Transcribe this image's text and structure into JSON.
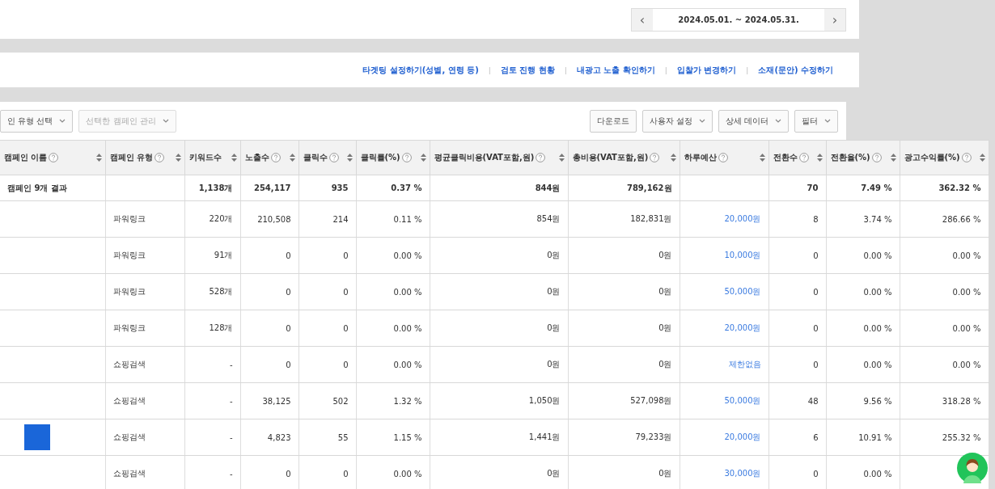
{
  "date_range": {
    "label": "2024.05.01. ~ 2024.05.31.",
    "prev": "‹",
    "next": "›"
  },
  "links": [
    {
      "kind": "link",
      "text": "타겟팅 설정하기(성별, 연령 등)"
    },
    {
      "kind": "separator",
      "text": "|"
    },
    {
      "kind": "link",
      "text": "검토 진행 현황"
    },
    {
      "kind": "separator",
      "text": "|"
    },
    {
      "kind": "link",
      "text": "내광고 노출 확인하기"
    },
    {
      "kind": "separator",
      "text": "|"
    },
    {
      "kind": "link",
      "text": "입찰가 변경하기"
    },
    {
      "kind": "separator",
      "text": "|"
    },
    {
      "kind": "link",
      "text": "소재(문안) 수정하기"
    }
  ],
  "toolbar_left": [
    {
      "label": "인 유형 선택",
      "disabled": false
    },
    {
      "label": "선택한 캠페인 관리",
      "disabled": true
    }
  ],
  "toolbar_right": [
    {
      "label": "다운로드",
      "dropdown": false
    },
    {
      "label": "사용자 설정",
      "dropdown": true
    },
    {
      "label": "상세 데이터",
      "dropdown": true
    },
    {
      "label": "필터",
      "dropdown": true
    }
  ],
  "table": {
    "columns": [
      {
        "label": "캠페인 이름",
        "help": true,
        "kind": "text"
      },
      {
        "label": "캠페인 유형",
        "help": true,
        "kind": "text"
      },
      {
        "label": "키워드수",
        "help": false,
        "kind": "number"
      },
      {
        "label": "노출수",
        "help": true,
        "kind": "number"
      },
      {
        "label": "클릭수",
        "help": true,
        "kind": "number"
      },
      {
        "label": "클릭률(%)",
        "help": true,
        "kind": "number"
      },
      {
        "label": "평균클릭비용(VAT포함,원)",
        "help": true,
        "kind": "number"
      },
      {
        "label": "총비용(VAT포함,원)",
        "help": true,
        "kind": "number"
      },
      {
        "label": "하루예산",
        "help": true,
        "kind": "link"
      },
      {
        "label": "전환수",
        "help": true,
        "kind": "number"
      },
      {
        "label": "전환율(%)",
        "help": true,
        "kind": "number"
      },
      {
        "label": "광고수익률(%)",
        "help": true,
        "kind": "number"
      }
    ],
    "total": {
      "campaign_name": "캠페인 9개 결과",
      "keywords": "1,138개",
      "impressions": "254,117",
      "clicks": "935",
      "ctr": "0.37 %",
      "avg_cpc": "844원",
      "total_cost": "789,162원",
      "conversions": "70",
      "conversion_rate": "7.49 %",
      "roas": "362.32 %"
    },
    "rows": [
      {
        "marked": false,
        "campaign_type": "파워링크",
        "keywords": "220개",
        "impressions": "210,508",
        "clicks": "214",
        "ctr": "0.11 %",
        "avg_cpc": "854원",
        "total_cost": "182,831원",
        "daily_budget": "20,000원",
        "conversions": "8",
        "conversion_rate": "3.74 %",
        "roas": "286.66 %"
      },
      {
        "marked": false,
        "campaign_type": "파워링크",
        "keywords": "91개",
        "impressions": "0",
        "clicks": "0",
        "ctr": "0.00 %",
        "avg_cpc": "0원",
        "total_cost": "0원",
        "daily_budget": "10,000원",
        "conversions": "0",
        "conversion_rate": "0.00 %",
        "roas": "0.00 %"
      },
      {
        "marked": false,
        "campaign_type": "파워링크",
        "keywords": "528개",
        "impressions": "0",
        "clicks": "0",
        "ctr": "0.00 %",
        "avg_cpc": "0원",
        "total_cost": "0원",
        "daily_budget": "50,000원",
        "conversions": "0",
        "conversion_rate": "0.00 %",
        "roas": "0.00 %"
      },
      {
        "marked": false,
        "campaign_type": "파워링크",
        "keywords": "128개",
        "impressions": "0",
        "clicks": "0",
        "ctr": "0.00 %",
        "avg_cpc": "0원",
        "total_cost": "0원",
        "daily_budget": "20,000원",
        "conversions": "0",
        "conversion_rate": "0.00 %",
        "roas": "0.00 %"
      },
      {
        "marked": false,
        "campaign_type": "쇼핑검색",
        "keywords": "-",
        "impressions": "0",
        "clicks": "0",
        "ctr": "0.00 %",
        "avg_cpc": "0원",
        "total_cost": "0원",
        "daily_budget": "제한없음",
        "conversions": "0",
        "conversion_rate": "0.00 %",
        "roas": "0.00 %"
      },
      {
        "marked": false,
        "campaign_type": "쇼핑검색",
        "keywords": "-",
        "impressions": "38,125",
        "clicks": "502",
        "ctr": "1.32 %",
        "avg_cpc": "1,050원",
        "total_cost": "527,098원",
        "daily_budget": "50,000원",
        "conversions": "48",
        "conversion_rate": "9.56 %",
        "roas": "318.28 %"
      },
      {
        "marked": true,
        "campaign_type": "쇼핑검색",
        "keywords": "-",
        "impressions": "4,823",
        "clicks": "55",
        "ctr": "1.15 %",
        "avg_cpc": "1,441원",
        "total_cost": "79,233원",
        "daily_budget": "20,000원",
        "conversions": "6",
        "conversion_rate": "10.91 %",
        "roas": "255.32 %"
      },
      {
        "marked": false,
        "campaign_type": "쇼핑검색",
        "keywords": "-",
        "impressions": "0",
        "clicks": "0",
        "ctr": "0.00 %",
        "avg_cpc": "0원",
        "total_cost": "0원",
        "daily_budget": "30,000원",
        "conversions": "0",
        "conversion_rate": "0.00 %"
      }
    ]
  }
}
